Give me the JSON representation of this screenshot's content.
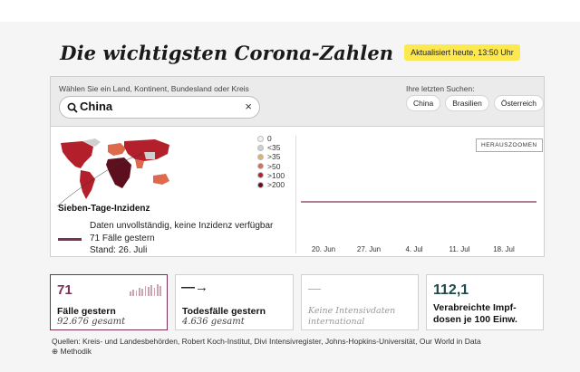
{
  "header": {
    "title": "Die wichtigsten Corona-Zahlen",
    "updated": "Aktualisiert heute, 13:50 Uhr"
  },
  "search": {
    "hint": "Wählen Sie ein Land, Kontinent, Bundesland oder Kreis",
    "value": "China",
    "clear_icon": "×",
    "recent_label": "Ihre letzten Suchen:",
    "recent": [
      "China",
      "Brasilien",
      "Österreich"
    ]
  },
  "legend": {
    "items": [
      {
        "label": "0",
        "color": "#f2f2f2"
      },
      {
        "label": "<35",
        "color": "#cfcfcf"
      },
      {
        "label": ">35",
        "color": "#e3b06a"
      },
      {
        "label": ">50",
        "color": "#de6a4e"
      },
      {
        "label": ">100",
        "color": "#b3202b"
      },
      {
        "label": ">200",
        "color": "#5e0f1d"
      }
    ]
  },
  "incidence": {
    "title": "Sieben-Tage-Inzidenz",
    "line1": "Daten unvollständig, keine Inzidenz verfügbar",
    "line2": "71 Fälle gestern",
    "line3": "Stand: 26. Juli",
    "line_color": "#7a3153"
  },
  "chart": {
    "zoom_label": "HERAUSZOOMEN",
    "x_ticks": [
      "20. Jun",
      "27. Jun",
      "4. Jul",
      "11. Jul",
      "18. Jul"
    ]
  },
  "cards": {
    "cases": {
      "value": "71",
      "label": "Fälle gestern",
      "sub": "92.676 gesamt"
    },
    "deaths": {
      "arrow": "—→",
      "label": "Todesfälle gestern",
      "sub": "4.636 gesamt"
    },
    "icu": {
      "dash": "—",
      "text": "Keine Intensivdaten international"
    },
    "vacc": {
      "value": "112,1",
      "label": "Verabreichte Impf-dosen je 100 Einw."
    }
  },
  "footer": {
    "sources": "Quellen: Kreis- und Landesbehörden, Robert Koch-Institut, Divi Intensivregister, Johns-Hopkins-Universität, Our World in Data",
    "method": "⊕ Methodik"
  },
  "colors": {
    "accent": "#7a3153",
    "highlight": "#fde84f",
    "teal": "#1d4a4a"
  }
}
